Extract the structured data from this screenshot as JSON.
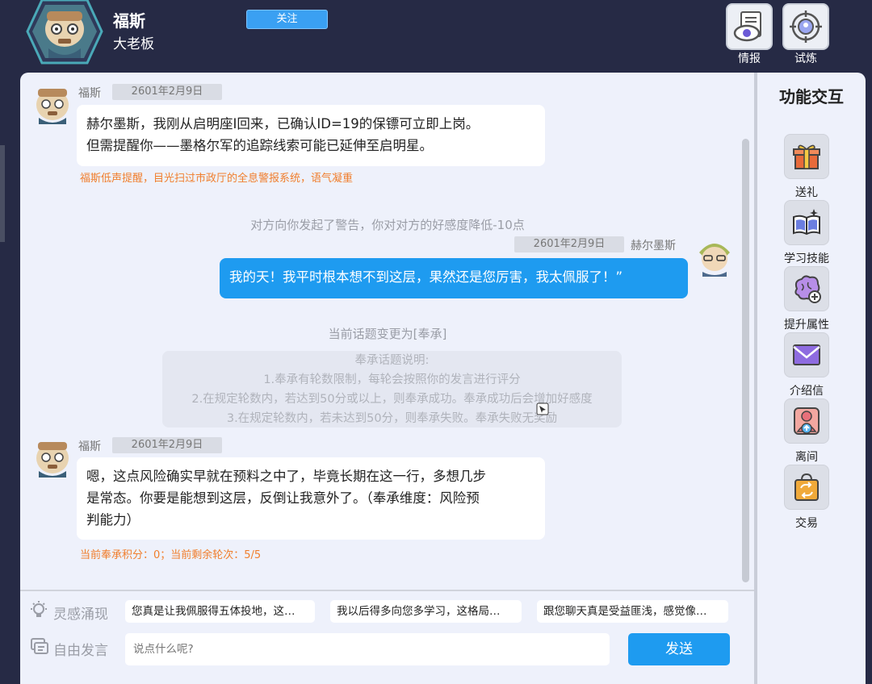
{
  "header": {
    "npc_name": "福斯",
    "npc_title": "大老板",
    "follow_label": "关注",
    "tools": [
      {
        "label": "情报",
        "icon": "eye-document-icon"
      },
      {
        "label": "试炼",
        "icon": "target-icon"
      }
    ]
  },
  "messages": {
    "m1": {
      "sender": "福斯",
      "date": "2601年2月9日",
      "text1": "赫尔墨斯，我刚从启明座Ⅰ回来，已确认ID=19的保镖可立即上岗。",
      "text2": "但需提醒你——墨格尔军的追踪线索可能已延伸至启明星。",
      "note": "福斯低声提醒，目光扫过市政厅的全息警报系统，语气凝重"
    },
    "system_warning": "对方向你发起了警告，你对对方的好感度降低-10点",
    "m2": {
      "sender": "赫尔墨斯",
      "date": "2601年2月9日",
      "text": "我的天！我平时根本想不到这层，果然还是您厉害，我太佩服了！”"
    },
    "topic_change": "当前话题变更为[奉承]",
    "topic_box": {
      "title": "奉承话题说明:",
      "line1": "1.奉承有轮数限制，每轮会按照你的发言进行评分",
      "line2": "2.在规定轮数内，若达到50分或以上，则奉承成功。奉承成功后会增加好感度",
      "line3": "3.在规定轮数内，若未达到50分，则奉承失败。奉承失败无奖励"
    },
    "m3": {
      "sender": "福斯",
      "date": "2601年2月9日",
      "text1": "嗯，这点风险确实早就在预料之中了，毕竟长期在这一行，多想几步",
      "text2": "是常态。你要是能想到这层，反倒让我意外了。（奉承维度：风险预",
      "text3": "判能力）",
      "note": "当前奉承积分：0；当前剩余轮次：5/5"
    }
  },
  "inspiration": {
    "label": "灵感涌现",
    "suggestions": [
      "您真是让我佩服得五体投地，这…",
      "我以后得多向您多学习，这格局…",
      "跟您聊天真是受益匪浅，感觉像…"
    ]
  },
  "free_speech": {
    "label": "自由发言",
    "placeholder": "说点什么呢?",
    "send_label": "发送"
  },
  "functions": {
    "title": "功能交互",
    "items": [
      {
        "label": "送礼",
        "icon": "gift-icon"
      },
      {
        "label": "学习技能",
        "icon": "book-icon"
      },
      {
        "label": "提升属性",
        "icon": "brain-plus-icon"
      },
      {
        "label": "介绍信",
        "icon": "envelope-icon"
      },
      {
        "label": "离间",
        "icon": "person-upload-icon"
      },
      {
        "label": "交易",
        "icon": "bag-exchange-icon"
      }
    ]
  },
  "colors": {
    "accent": "#1e9bf0",
    "note_orange": "#f07e2c",
    "background": "#262a45",
    "panel": "#eef1fb"
  }
}
